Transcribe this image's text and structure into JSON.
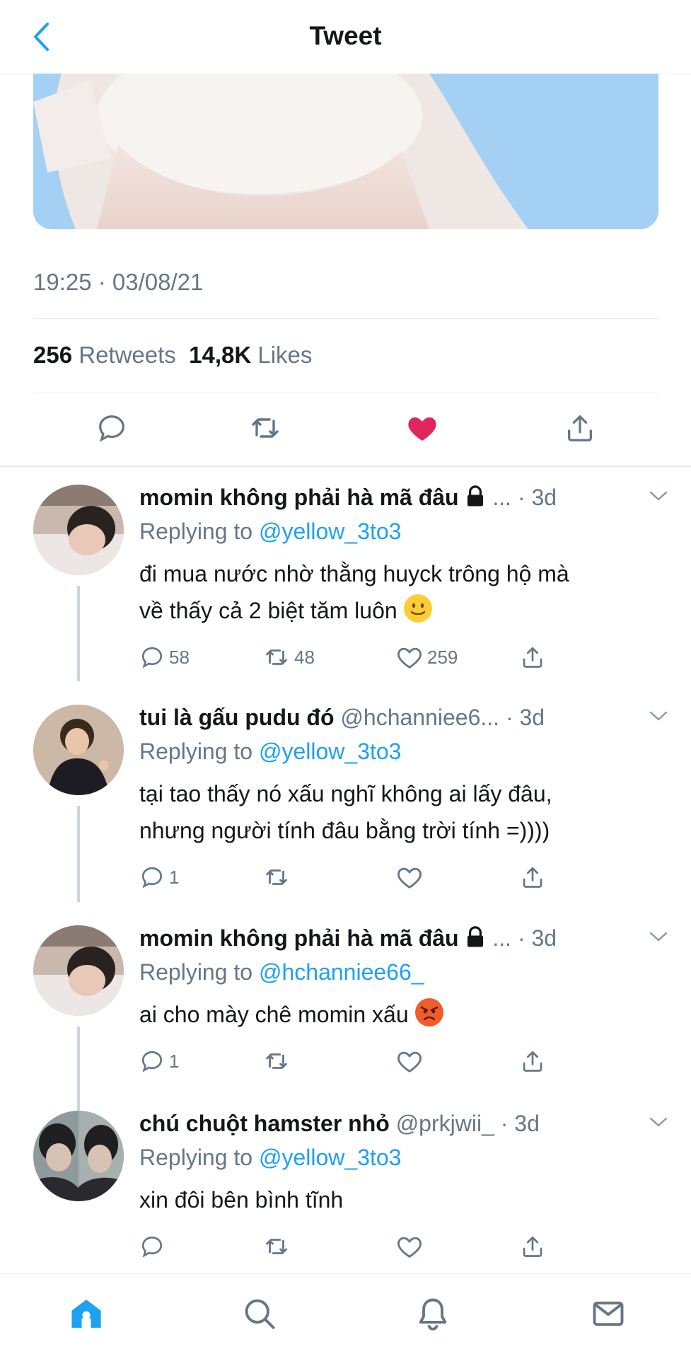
{
  "header": {
    "title": "Tweet"
  },
  "tweet": {
    "timestamp": "19:25 · 03/08/21",
    "retweet_count": "256",
    "retweet_label": "Retweets",
    "like_count": "14,8K",
    "like_label": "Likes",
    "liked": true
  },
  "replies": [
    {
      "name": "momin không phải hà mã đâu",
      "handle": "...",
      "time": "· 3d",
      "replying_prefix": "Replying to",
      "replying_to": "@yellow_3to3",
      "text_lines": [
        "đi mua nước nhờ thằng huyck trông hộ mà",
        "về thấy cả 2 biệt tăm luôn"
      ],
      "emoji": "slightly-smiling-face",
      "reply_count": "58",
      "retweet_count": "48",
      "like_count": "259"
    },
    {
      "name": "tui là gấu pudu đó",
      "handle": "@hchanniee6...",
      "time": "· 3d",
      "replying_prefix": "Replying to",
      "replying_to": "@yellow_3to3",
      "text_lines": [
        "tại tao thấy nó xấu nghĩ không ai lấy đâu,",
        "nhưng người tính đâu bằng trời tính =))))"
      ],
      "reply_count": "1",
      "retweet_count": "",
      "like_count": ""
    },
    {
      "name": "momin không phải hà mã đâu",
      "handle": "...",
      "time": "· 3d",
      "replying_prefix": "Replying to",
      "replying_to": "@hchanniee66_",
      "text_lines": [
        "ai cho mày chê momin xấu"
      ],
      "emoji": "angry-face",
      "reply_count": "1",
      "retweet_count": "",
      "like_count": ""
    },
    {
      "name": "chú chuột hamster nhỏ",
      "handle": "@prkjwii_",
      "time": "· 3d",
      "replying_prefix": "Replying to",
      "replying_to": "@yellow_3to3",
      "text_lines": [
        "xin đôi bên bình tĩnh"
      ],
      "reply_count": "",
      "retweet_count": "",
      "like_count": ""
    }
  ],
  "bottom_nav": [
    "home-icon",
    "search-icon",
    "notifications-icon",
    "messages-icon"
  ],
  "colors": {
    "accent": "#1da1f2",
    "like": "#e0245e",
    "muted": "#657786"
  }
}
